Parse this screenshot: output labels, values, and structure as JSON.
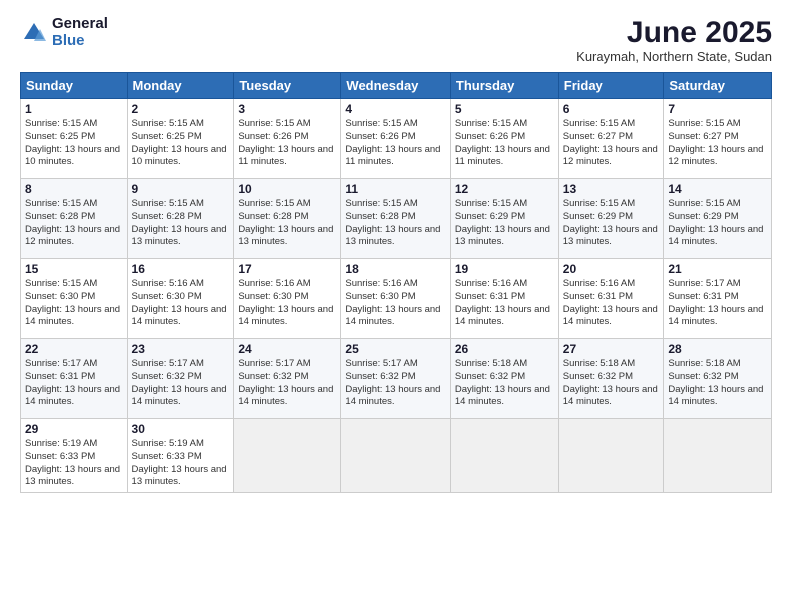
{
  "logo": {
    "general": "General",
    "blue": "Blue"
  },
  "header": {
    "month": "June 2025",
    "location": "Kuraymah, Northern State, Sudan"
  },
  "weekdays": [
    "Sunday",
    "Monday",
    "Tuesday",
    "Wednesday",
    "Thursday",
    "Friday",
    "Saturday"
  ],
  "weeks": [
    [
      {
        "day": "1",
        "sunrise": "5:15 AM",
        "sunset": "6:25 PM",
        "daylight": "13 hours and 10 minutes."
      },
      {
        "day": "2",
        "sunrise": "5:15 AM",
        "sunset": "6:25 PM",
        "daylight": "13 hours and 10 minutes."
      },
      {
        "day": "3",
        "sunrise": "5:15 AM",
        "sunset": "6:26 PM",
        "daylight": "13 hours and 11 minutes."
      },
      {
        "day": "4",
        "sunrise": "5:15 AM",
        "sunset": "6:26 PM",
        "daylight": "13 hours and 11 minutes."
      },
      {
        "day": "5",
        "sunrise": "5:15 AM",
        "sunset": "6:26 PM",
        "daylight": "13 hours and 11 minutes."
      },
      {
        "day": "6",
        "sunrise": "5:15 AM",
        "sunset": "6:27 PM",
        "daylight": "13 hours and 12 minutes."
      },
      {
        "day": "7",
        "sunrise": "5:15 AM",
        "sunset": "6:27 PM",
        "daylight": "13 hours and 12 minutes."
      }
    ],
    [
      {
        "day": "8",
        "sunrise": "5:15 AM",
        "sunset": "6:28 PM",
        "daylight": "13 hours and 12 minutes."
      },
      {
        "day": "9",
        "sunrise": "5:15 AM",
        "sunset": "6:28 PM",
        "daylight": "13 hours and 13 minutes."
      },
      {
        "day": "10",
        "sunrise": "5:15 AM",
        "sunset": "6:28 PM",
        "daylight": "13 hours and 13 minutes."
      },
      {
        "day": "11",
        "sunrise": "5:15 AM",
        "sunset": "6:28 PM",
        "daylight": "13 hours and 13 minutes."
      },
      {
        "day": "12",
        "sunrise": "5:15 AM",
        "sunset": "6:29 PM",
        "daylight": "13 hours and 13 minutes."
      },
      {
        "day": "13",
        "sunrise": "5:15 AM",
        "sunset": "6:29 PM",
        "daylight": "13 hours and 13 minutes."
      },
      {
        "day": "14",
        "sunrise": "5:15 AM",
        "sunset": "6:29 PM",
        "daylight": "13 hours and 14 minutes."
      }
    ],
    [
      {
        "day": "15",
        "sunrise": "5:15 AM",
        "sunset": "6:30 PM",
        "daylight": "13 hours and 14 minutes."
      },
      {
        "day": "16",
        "sunrise": "5:16 AM",
        "sunset": "6:30 PM",
        "daylight": "13 hours and 14 minutes."
      },
      {
        "day": "17",
        "sunrise": "5:16 AM",
        "sunset": "6:30 PM",
        "daylight": "13 hours and 14 minutes."
      },
      {
        "day": "18",
        "sunrise": "5:16 AM",
        "sunset": "6:30 PM",
        "daylight": "13 hours and 14 minutes."
      },
      {
        "day": "19",
        "sunrise": "5:16 AM",
        "sunset": "6:31 PM",
        "daylight": "13 hours and 14 minutes."
      },
      {
        "day": "20",
        "sunrise": "5:16 AM",
        "sunset": "6:31 PM",
        "daylight": "13 hours and 14 minutes."
      },
      {
        "day": "21",
        "sunrise": "5:17 AM",
        "sunset": "6:31 PM",
        "daylight": "13 hours and 14 minutes."
      }
    ],
    [
      {
        "day": "22",
        "sunrise": "5:17 AM",
        "sunset": "6:31 PM",
        "daylight": "13 hours and 14 minutes."
      },
      {
        "day": "23",
        "sunrise": "5:17 AM",
        "sunset": "6:32 PM",
        "daylight": "13 hours and 14 minutes."
      },
      {
        "day": "24",
        "sunrise": "5:17 AM",
        "sunset": "6:32 PM",
        "daylight": "13 hours and 14 minutes."
      },
      {
        "day": "25",
        "sunrise": "5:17 AM",
        "sunset": "6:32 PM",
        "daylight": "13 hours and 14 minutes."
      },
      {
        "day": "26",
        "sunrise": "5:18 AM",
        "sunset": "6:32 PM",
        "daylight": "13 hours and 14 minutes."
      },
      {
        "day": "27",
        "sunrise": "5:18 AM",
        "sunset": "6:32 PM",
        "daylight": "13 hours and 14 minutes."
      },
      {
        "day": "28",
        "sunrise": "5:18 AM",
        "sunset": "6:32 PM",
        "daylight": "13 hours and 14 minutes."
      }
    ],
    [
      {
        "day": "29",
        "sunrise": "5:19 AM",
        "sunset": "6:33 PM",
        "daylight": "13 hours and 13 minutes."
      },
      {
        "day": "30",
        "sunrise": "5:19 AM",
        "sunset": "6:33 PM",
        "daylight": "13 hours and 13 minutes."
      },
      null,
      null,
      null,
      null,
      null
    ]
  ]
}
